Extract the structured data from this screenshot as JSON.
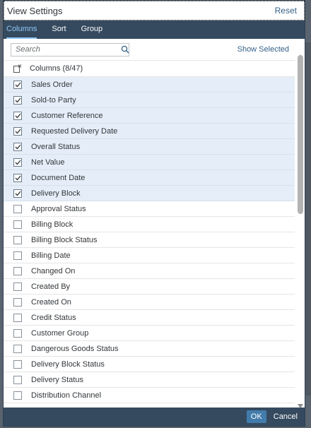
{
  "dialog": {
    "title": "View Settings",
    "reset_label": "Reset"
  },
  "tabs": [
    {
      "label": "Columns",
      "active": true
    },
    {
      "label": "Sort",
      "active": false
    },
    {
      "label": "Group",
      "active": false
    }
  ],
  "toolbar": {
    "search_placeholder": "Search",
    "search_value": "",
    "show_selected_label": "Show Selected"
  },
  "list": {
    "header_label": "Columns (8/47)",
    "items": [
      {
        "label": "Sales Order",
        "checked": true
      },
      {
        "label": "Sold-to Party",
        "checked": true
      },
      {
        "label": "Customer Reference",
        "checked": true
      },
      {
        "label": "Requested Delivery Date",
        "checked": true
      },
      {
        "label": "Overall Status",
        "checked": true
      },
      {
        "label": "Net Value",
        "checked": true
      },
      {
        "label": "Document Date",
        "checked": true
      },
      {
        "label": "Delivery Block",
        "checked": true
      },
      {
        "label": "Approval Status",
        "checked": false
      },
      {
        "label": "Billing Block",
        "checked": false
      },
      {
        "label": "Billing Block Status",
        "checked": false
      },
      {
        "label": "Billing Date",
        "checked": false
      },
      {
        "label": "Changed On",
        "checked": false
      },
      {
        "label": "Created By",
        "checked": false
      },
      {
        "label": "Created On",
        "checked": false
      },
      {
        "label": "Credit Status",
        "checked": false
      },
      {
        "label": "Customer Group",
        "checked": false
      },
      {
        "label": "Dangerous Goods Status",
        "checked": false
      },
      {
        "label": "Delivery Block Status",
        "checked": false
      },
      {
        "label": "Delivery Status",
        "checked": false
      },
      {
        "label": "Distribution Channel",
        "checked": false
      }
    ]
  },
  "footer": {
    "ok_label": "OK",
    "cancel_label": "Cancel"
  },
  "colors": {
    "accent": "#427cac",
    "bar": "#354a5f",
    "selected_row": "#e5eef8"
  }
}
